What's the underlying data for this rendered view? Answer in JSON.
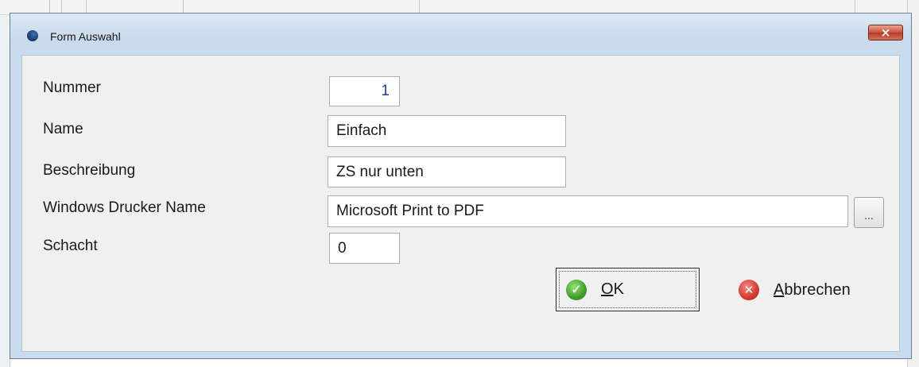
{
  "dialog": {
    "title": "Form Auswahl",
    "close_glyph": "×"
  },
  "fields": {
    "nummer": {
      "label": "Nummer",
      "value": "1"
    },
    "name": {
      "label": "Name",
      "value": "Einfach"
    },
    "beschreibung": {
      "label": "Beschreibung",
      "value": "ZS nur unten"
    },
    "drucker": {
      "label": "Windows Drucker Name",
      "value": "Microsoft Print to PDF",
      "browse_label": "..."
    },
    "schacht": {
      "label": "Schacht",
      "value": "0"
    }
  },
  "buttons": {
    "ok": {
      "mnemonic": "O",
      "rest": "K",
      "icon": "check-icon"
    },
    "cancel": {
      "mnemonic": "A",
      "rest": "bbrechen",
      "icon": "cancel-icon"
    }
  },
  "colors": {
    "title_bg": "#c7d9ea",
    "close_red": "#c9523d",
    "ok_green": "#3f9e27",
    "cancel_red": "#d53a2f",
    "number_blue": "#1f3f8a"
  }
}
